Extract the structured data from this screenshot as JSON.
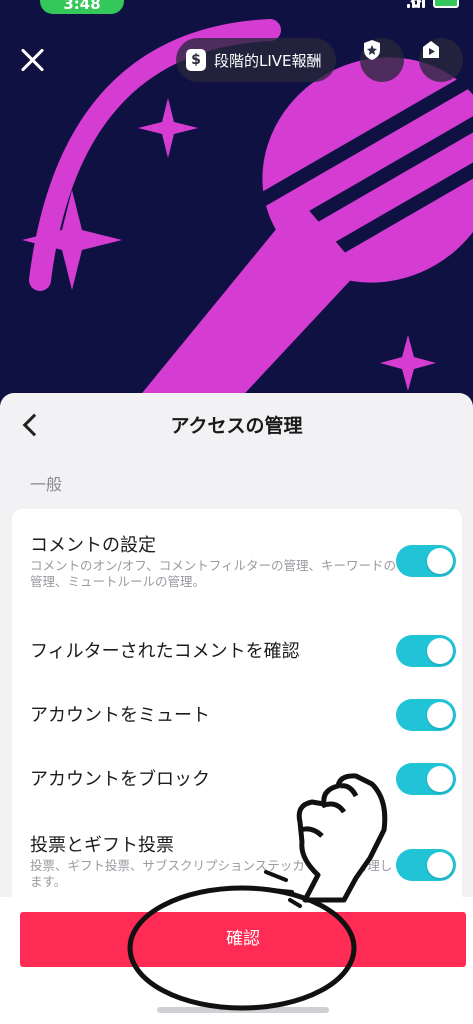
{
  "status_bar": {
    "time": "3:48"
  },
  "header": {
    "reward_label": "段階的LIVE報酬",
    "reward_coin": "$"
  },
  "sheet": {
    "title": "アクセスの管理",
    "section": "一般",
    "rows": [
      {
        "title": "コメントの設定",
        "desc": "コメントのオン/オフ、コメントフィルターの管理、キーワードの管理、ミュートルールの管理。",
        "enabled": true
      },
      {
        "title": "フィルターされたコメントを確認",
        "enabled": true
      },
      {
        "title": "アカウントをミュート",
        "enabled": true
      },
      {
        "title": "アカウントをブロック",
        "enabled": true
      },
      {
        "title": "投票とギフト投票",
        "desc": "投票、ギフト投票、サブスクリプションステッカー投票を管理します。",
        "enabled": true
      }
    ]
  },
  "confirm_label": "確認",
  "colors": {
    "accent": "#fe2c55",
    "toggle": "#20c4d6",
    "hero_bg": "#0e1142",
    "hero_art": "#d53cd1"
  }
}
